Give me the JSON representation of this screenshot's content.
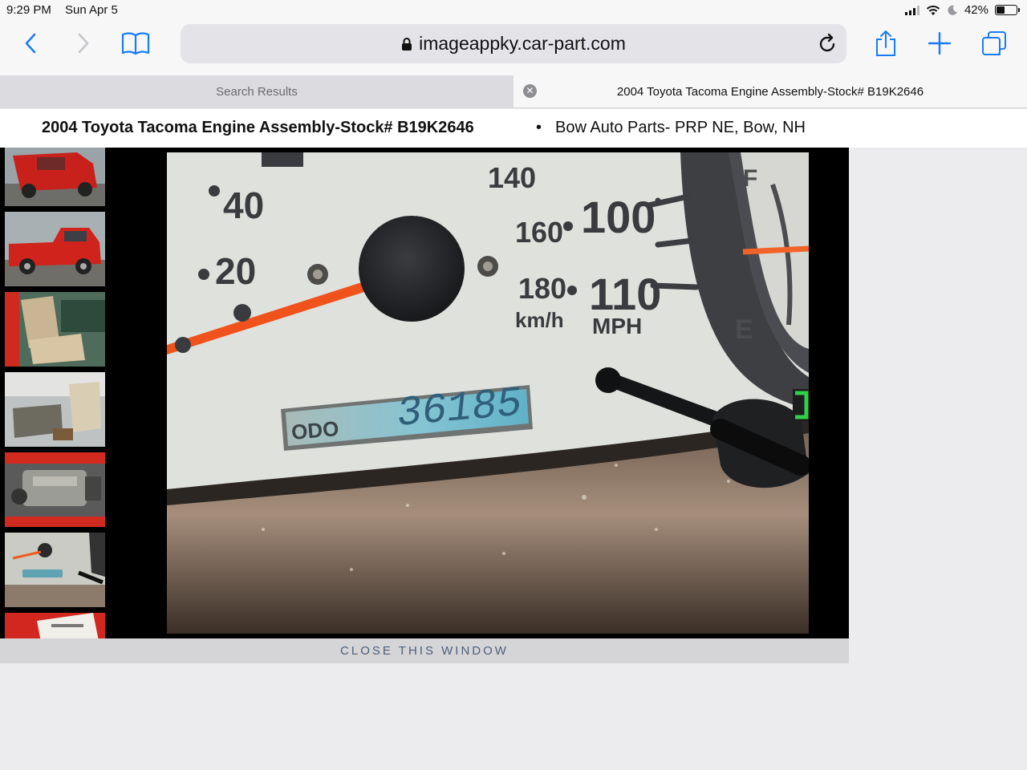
{
  "status_bar": {
    "time": "9:29 PM",
    "date": "Sun Apr 5",
    "battery": "42%",
    "battery_level": 0.42
  },
  "browser": {
    "url": "imageappky.car-part.com",
    "tabs": [
      {
        "label": "Search Results",
        "active": false
      },
      {
        "label": "2004 Toyota Tacoma Engine Assembly-Stock# B19K2646",
        "active": true
      }
    ],
    "accent_color": "#1a7cf5"
  },
  "page": {
    "title": "2004 Toyota Tacoma Engine Assembly-Stock# B19K2646",
    "separator": "•",
    "seller": "Bow Auto Parts- PRP NE, Bow, NH",
    "close_label": "CLOSE THIS WINDOW"
  },
  "gauge": {
    "speed_mph": [
      "40",
      "20",
      "100",
      "110"
    ],
    "speed_kmh": [
      "140",
      "160",
      "180"
    ],
    "kmh_unit": "km/h",
    "mph_unit": "MPH",
    "odo_label": "ODO",
    "odometer": "36185",
    "fuel_full": "F",
    "fuel_empty": "E"
  },
  "thumbnails": [
    {
      "name": "red-truck-rear"
    },
    {
      "name": "red-truck-side"
    },
    {
      "name": "interior-seats"
    },
    {
      "name": "interior-rear"
    },
    {
      "name": "engine-bay"
    },
    {
      "name": "instrument-cluster"
    },
    {
      "name": "stock-tag"
    }
  ]
}
